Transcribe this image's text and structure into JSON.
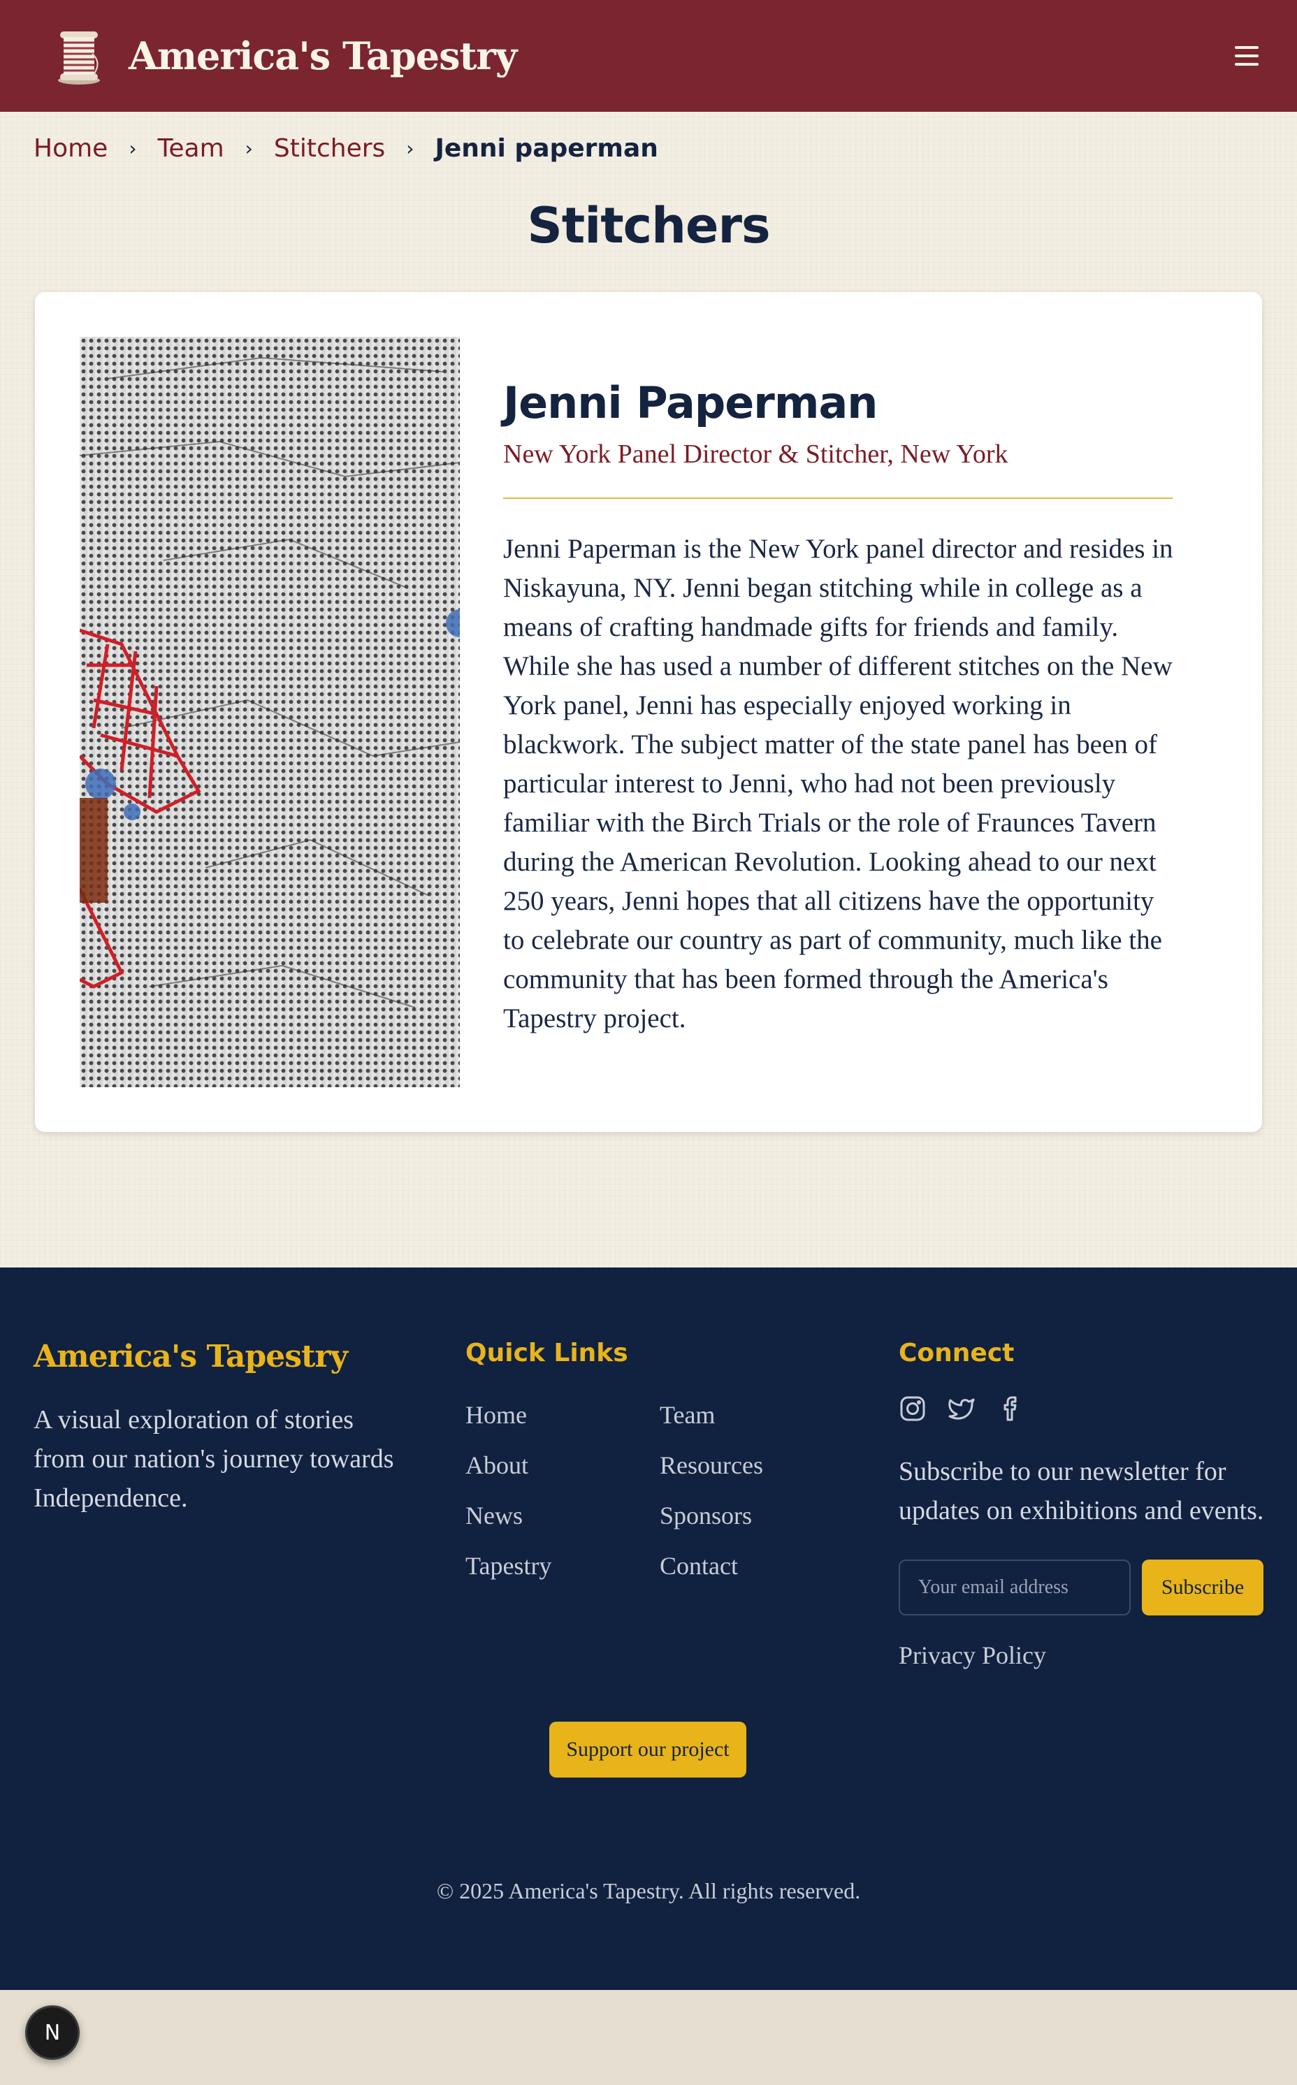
{
  "header": {
    "brand": "America's Tapestry",
    "logo_icon": "thread-spool-icon",
    "menu_icon": "hamburger-menu-icon"
  },
  "breadcrumb": {
    "items": [
      "Home",
      "Team",
      "Stitchers"
    ],
    "current": "Jenni paperman",
    "separator_icon": "chevron-right-icon"
  },
  "page": {
    "title": "Stitchers"
  },
  "profile": {
    "name": "Jenni Paperman",
    "role": "New York Panel Director & Stitcher, New York",
    "bio": "Jenni Paperman is the New York panel director and resides in Niskayuna, NY. Jenni began stitching while in college as a means of crafting handmade gifts for friends and family. While she has used a number of different stitches on the New York panel, Jenni has especially enjoyed working in blackwork. The subject matter of the state panel has been of particular interest to Jenni, who had not been previously familiar with the Birch Trials or the role of Fraunces Tavern during the American Revolution. Looking ahead to our next 250 years, Jenni hopes that all citizens have the opportunity to celebrate our country as part of community, much like the community that has been formed through the America's Tapestry project."
  },
  "footer": {
    "brand": "America's Tapestry",
    "tagline": "A visual exploration of stories from our nation's journey towards Independence.",
    "quick_links_heading": "Quick Links",
    "quick_links": [
      "Home",
      "Team",
      "About",
      "Resources",
      "News",
      "Sponsors",
      "Tapestry",
      "Contact"
    ],
    "connect_heading": "Connect",
    "social_icons": [
      "instagram-icon",
      "twitter-icon",
      "facebook-icon"
    ],
    "newsletter_text": "Subscribe to our newsletter for updates on exhibitions and events.",
    "email_placeholder": "Your email address",
    "subscribe_label": "Subscribe",
    "privacy_label": "Privacy Policy",
    "support_label": "Support our project",
    "copyright": "© 2025 America's Tapestry. All rights reserved."
  },
  "dev_badge": {
    "label": "N"
  },
  "colors": {
    "header_bg": "#7b2531",
    "accent_gold": "#e8b41a",
    "navy": "#14233f",
    "footer_bg": "#112140",
    "maroon_text": "#7b1c24"
  }
}
